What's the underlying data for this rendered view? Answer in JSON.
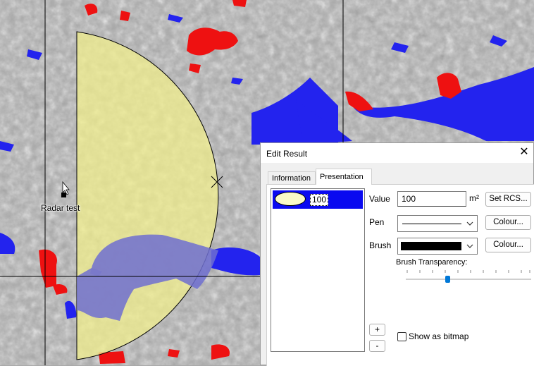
{
  "map": {
    "marker_label": "Radar test",
    "colors": {
      "terrain": "#a9a9a9",
      "water": "#2222ee",
      "urban": "#ee1111",
      "coverage_fill": "#f2f08a",
      "grid_line": "#000000"
    }
  },
  "dialog": {
    "title": "Edit Result",
    "close_label": "✕",
    "tabs": [
      {
        "label": "Information",
        "active": false
      },
      {
        "label": "Presentation",
        "active": true
      }
    ],
    "list": {
      "items": [
        {
          "value": "100",
          "swatch_color": "#fafac8",
          "selected": true
        }
      ]
    },
    "value_label": "Value",
    "value": "100",
    "unit": "m²",
    "set_rcs_label": "Set RCS...",
    "pen_label": "Pen",
    "brush_label": "Brush",
    "colour_label": "Colour...",
    "brush_color": "#000000",
    "brush_transparency_label": "Brush Transparency:",
    "brush_transparency_fraction": 0.33,
    "add_label": "+",
    "remove_label": "-",
    "show_bitmap_label": "Show as bitmap",
    "show_bitmap_checked": false,
    "accent_color": "#0a0af0"
  }
}
